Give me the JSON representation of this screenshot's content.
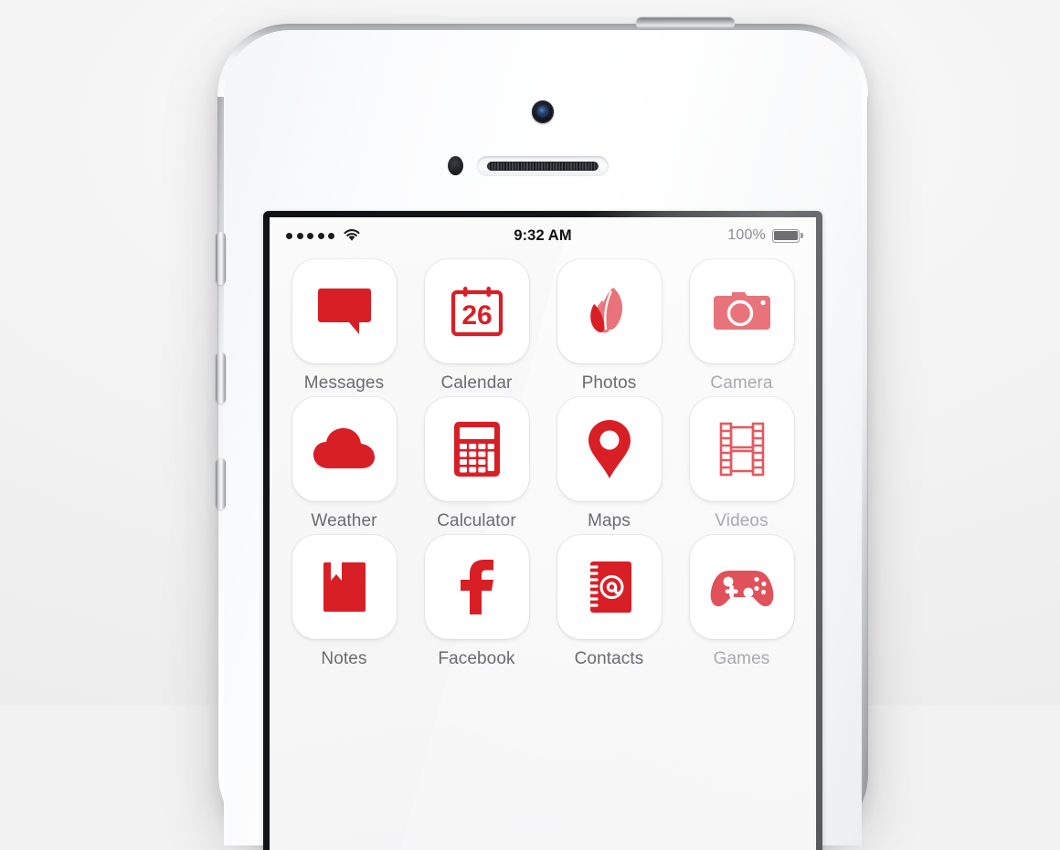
{
  "device": {
    "name": "white-smartphone",
    "components": {
      "front_camera": "front-camera",
      "proximity_sensor": "proximity-sensor-icon",
      "earpiece_speaker": "earpiece-speaker",
      "power_button": "power-button",
      "silent_switch": "silent-switch",
      "volume_up": "volume-up-button",
      "volume_down": "volume-down-button"
    }
  },
  "status_bar": {
    "signal_dots": 5,
    "wifi_icon": "wifi-icon",
    "time": "9:32 AM",
    "battery_percent": "100%",
    "battery_icon": "battery-full-icon"
  },
  "colors": {
    "accent_red": "#d81f26",
    "accent_red_soft": "#e8737a",
    "label_grey": "#6b6b70",
    "label_grey_dim": "#a9a9ae",
    "tile_white": "#ffffff",
    "screen_bg": "#f7f7f7"
  },
  "home_screen": {
    "apps": [
      {
        "label": "Messages",
        "icon": "messages-icon",
        "dim": false
      },
      {
        "label": "Calendar",
        "icon": "calendar-icon",
        "dim": false,
        "badge_text": "26"
      },
      {
        "label": "Photos",
        "icon": "photos-icon",
        "dim": false
      },
      {
        "label": "Camera",
        "icon": "camera-icon",
        "dim": true
      },
      {
        "label": "Weather",
        "icon": "weather-icon",
        "dim": false
      },
      {
        "label": "Calculator",
        "icon": "calculator-icon",
        "dim": false
      },
      {
        "label": "Maps",
        "icon": "maps-pin-icon",
        "dim": false
      },
      {
        "label": "Videos",
        "icon": "videos-icon",
        "dim": true
      },
      {
        "label": "Notes",
        "icon": "notes-icon",
        "dim": false
      },
      {
        "label": "Facebook",
        "icon": "facebook-icon",
        "dim": false,
        "glyph": "f"
      },
      {
        "label": "Contacts",
        "icon": "contacts-icon",
        "dim": false,
        "glyph": "@"
      },
      {
        "label": "Games",
        "icon": "games-icon",
        "dim": true
      }
    ]
  }
}
